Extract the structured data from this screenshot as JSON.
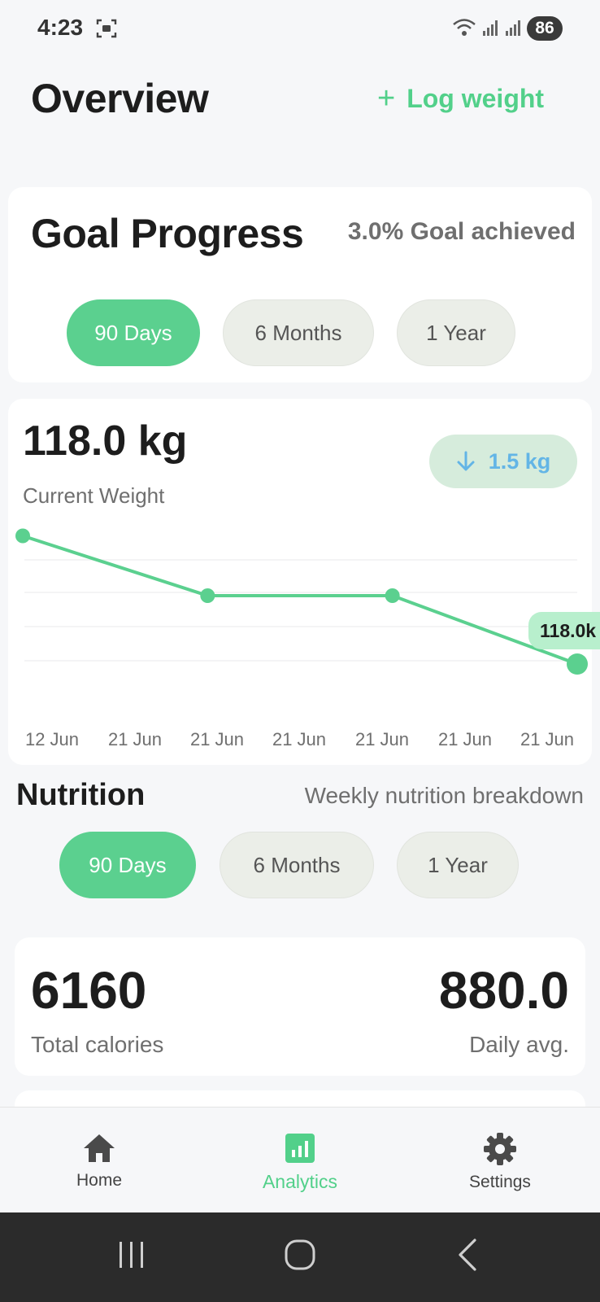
{
  "status_bar": {
    "time": "4:23",
    "battery": "86"
  },
  "header": {
    "title": "Overview",
    "log_weight_label": "Log weight"
  },
  "goal_progress": {
    "title": "Goal Progress",
    "achieved_text": "3.0% Goal achieved",
    "ranges": [
      "90 Days",
      "6 Months",
      "1 Year"
    ],
    "active_range": "90 Days"
  },
  "weight": {
    "current_value": "118.0 kg",
    "label": "Current Weight",
    "delta": "1.5 kg",
    "tooltip": "118.0k"
  },
  "chart_data": {
    "type": "line",
    "x_tick_labels": [
      "12 Jun",
      "21 Jun",
      "21 Jun",
      "21 Jun",
      "21 Jun",
      "21 Jun",
      "21 Jun"
    ],
    "series": [
      {
        "values": [
          119.5,
          118.8,
          118.8,
          118.0
        ]
      }
    ],
    "ylim": [
      117.6,
      119.6
    ],
    "grid": true,
    "color": "#5bd08f"
  },
  "nutrition": {
    "title": "Nutrition",
    "subtitle": "Weekly nutrition breakdown",
    "ranges": [
      "90 Days",
      "6 Months",
      "1 Year"
    ],
    "active_range": "90 Days",
    "total_calories": "6160",
    "total_calories_label": "Total calories",
    "daily_avg": "880.0",
    "daily_avg_label": "Daily avg."
  },
  "bottom_nav": {
    "items": [
      {
        "label": "Home",
        "icon": "home-icon"
      },
      {
        "label": "Analytics",
        "icon": "analytics-icon"
      },
      {
        "label": "Settings",
        "icon": "gear-icon"
      }
    ],
    "active": "Analytics"
  },
  "colors": {
    "accent": "#5bd08f",
    "delta_text": "#63b5e6",
    "delta_bg": "#d6ecdc"
  }
}
